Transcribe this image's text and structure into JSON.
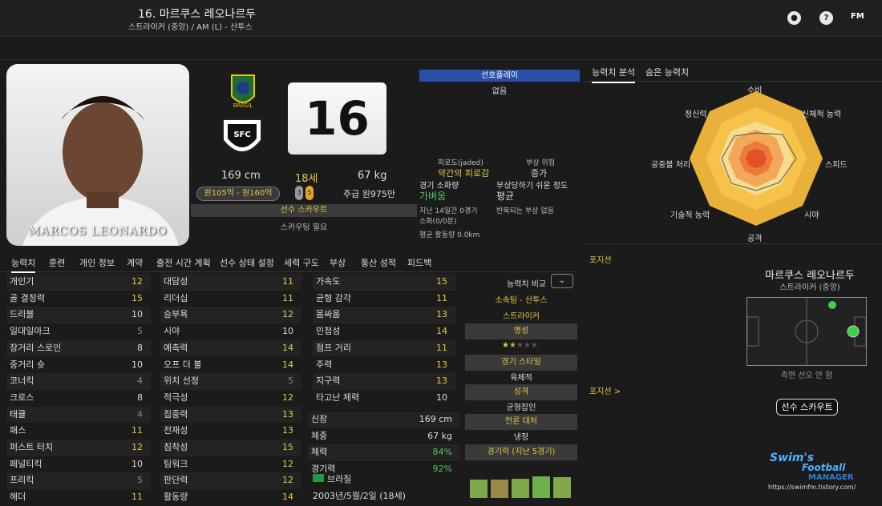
{
  "header": {
    "player_name": "16. 마르쿠스 레오나르두",
    "position_line": "스트라이커 (중앙) / AM (L) - 산투스",
    "fm_label": "FM"
  },
  "photo": {
    "caption": "MARCOS LEONARDO"
  },
  "club": {
    "shirt_number": "16",
    "country_badge": "BRASIL"
  },
  "vitals": {
    "height": "169 cm",
    "age": "18세",
    "weight": "67 kg",
    "wage_range": "원105억 - 원160억",
    "wage": "주급 원975만",
    "foot_left": "3",
    "foot_right": "5"
  },
  "scout": {
    "label": "선수 스카우트",
    "need": "스카우팅 필요"
  },
  "favored": {
    "title": "선호플레이",
    "value": "없음"
  },
  "condition": {
    "fatigue_label": "피로도(jaded)",
    "fatigue_value": "약간의 피로감",
    "injury_label": "부상 위험",
    "injury_value": "증가",
    "match_load_label": "경기 소화량",
    "match_load_value": "가벼움",
    "proneness_label": "부상당하기 쉬운 정도",
    "proneness_value": "평균",
    "recent_load": "지난 14일간 0경기",
    "recent_min": "소화(0/0분)",
    "recurring": "반복되는 부상 없음",
    "avg_run": "평균 활동량 0.0km"
  },
  "tabs": [
    "능력치",
    "훈련",
    "개인 정보",
    "계약",
    "출전 시간 계획",
    "선수 상태 설정",
    "세력 구도",
    "부상",
    "통산 성적",
    "피드백"
  ],
  "technical": [
    {
      "label": "개인기",
      "value": "12",
      "c": "y"
    },
    {
      "label": "골 결정력",
      "value": "15",
      "c": "y"
    },
    {
      "label": "드리블",
      "value": "10",
      "c": "w"
    },
    {
      "label": "일대일마크",
      "value": "5",
      "c": "gr"
    },
    {
      "label": "장거리 스로인",
      "value": "8",
      "c": "w"
    },
    {
      "label": "중거리 슛",
      "value": "10",
      "c": "w"
    },
    {
      "label": "코너킥",
      "value": "4",
      "c": "gr"
    },
    {
      "label": "크로스",
      "value": "8",
      "c": "w"
    },
    {
      "label": "태클",
      "value": "4",
      "c": "gr"
    },
    {
      "label": "패스",
      "value": "11",
      "c": "y"
    },
    {
      "label": "퍼스트 터치",
      "value": "12",
      "c": "y"
    },
    {
      "label": "페널티킥",
      "value": "10",
      "c": "w"
    },
    {
      "label": "프리킥",
      "value": "5",
      "c": "gr"
    },
    {
      "label": "헤더",
      "value": "11",
      "c": "y"
    }
  ],
  "mental": [
    {
      "label": "대담성",
      "value": "11",
      "c": "y"
    },
    {
      "label": "리더십",
      "value": "11",
      "c": "y"
    },
    {
      "label": "승부욕",
      "value": "12",
      "c": "y"
    },
    {
      "label": "시야",
      "value": "10",
      "c": "w"
    },
    {
      "label": "예측력",
      "value": "14",
      "c": "y"
    },
    {
      "label": "오프 더 볼",
      "value": "14",
      "c": "y"
    },
    {
      "label": "위치 선정",
      "value": "5",
      "c": "gr"
    },
    {
      "label": "적극성",
      "value": "12",
      "c": "y"
    },
    {
      "label": "집중력",
      "value": "13",
      "c": "y"
    },
    {
      "label": "전재성",
      "value": "13",
      "c": "y"
    },
    {
      "label": "침착성",
      "value": "15",
      "c": "y"
    },
    {
      "label": "팀워크",
      "value": "12",
      "c": "y"
    },
    {
      "label": "판단력",
      "value": "12",
      "c": "y"
    },
    {
      "label": "활동량",
      "value": "14",
      "c": "y"
    }
  ],
  "physical": [
    {
      "label": "가속도",
      "value": "15",
      "c": "y"
    },
    {
      "label": "균형 감각",
      "value": "11",
      "c": "y"
    },
    {
      "label": "몸싸움",
      "value": "13",
      "c": "y"
    },
    {
      "label": "민첩성",
      "value": "14",
      "c": "y"
    },
    {
      "label": "점프 거리",
      "value": "11",
      "c": "y"
    },
    {
      "label": "주력",
      "value": "13",
      "c": "y"
    },
    {
      "label": "지구력",
      "value": "13",
      "c": "y"
    },
    {
      "label": "타고난 체력",
      "value": "10",
      "c": "w"
    }
  ],
  "bio": [
    {
      "label": "신장",
      "value": "169 cm",
      "c": "w"
    },
    {
      "label": "체중",
      "value": "67 kg",
      "c": "w"
    },
    {
      "label": "체력",
      "value": "84%",
      "c": "g"
    },
    {
      "label": "경기력",
      "value": "92%",
      "c": "g"
    }
  ],
  "nationality": "브라질",
  "dob": "2003년/5월/2일 (18세)",
  "compare": {
    "title": "능력치 비교",
    "team": "소속팀 - 산투스",
    "role": "스트라이커",
    "reputation_label": "명성",
    "stars": 1.5,
    "style_label": "경기 스타일",
    "style_value": "육체적",
    "personality_label": "성격",
    "personality_value": "균형잡인",
    "media_label": "언론 대처",
    "media_value": "냉정",
    "form_label": "경기력 (지난 5경기)",
    "form": [
      0.6,
      0.6,
      0.62,
      0.7,
      0.68
    ]
  },
  "right_tabs": [
    "능력치 분석",
    "숨은 능력치"
  ],
  "radar": {
    "labels": [
      "수비",
      "신체적 능력",
      "스피드",
      "시야",
      "공격",
      "기술적 능력",
      "공중볼 처리",
      "정신력"
    ]
  },
  "position_panel": {
    "label": "포지션",
    "name": "마르쿠스 레오나르두",
    "pos": "스트라이커 (중앙)",
    "role": "측면 선오 안 함",
    "label2": "포지션 >",
    "scout_button": "선수 스카우트"
  },
  "watermark": {
    "line1": "Swim's",
    "line2": "Football",
    "line3": "MANAGER",
    "url": "https://swimfm.tistory.com/"
  },
  "colors": {
    "accent": "#e7c843",
    "good": "#58c75c",
    "blue": "#2a4fa8"
  }
}
